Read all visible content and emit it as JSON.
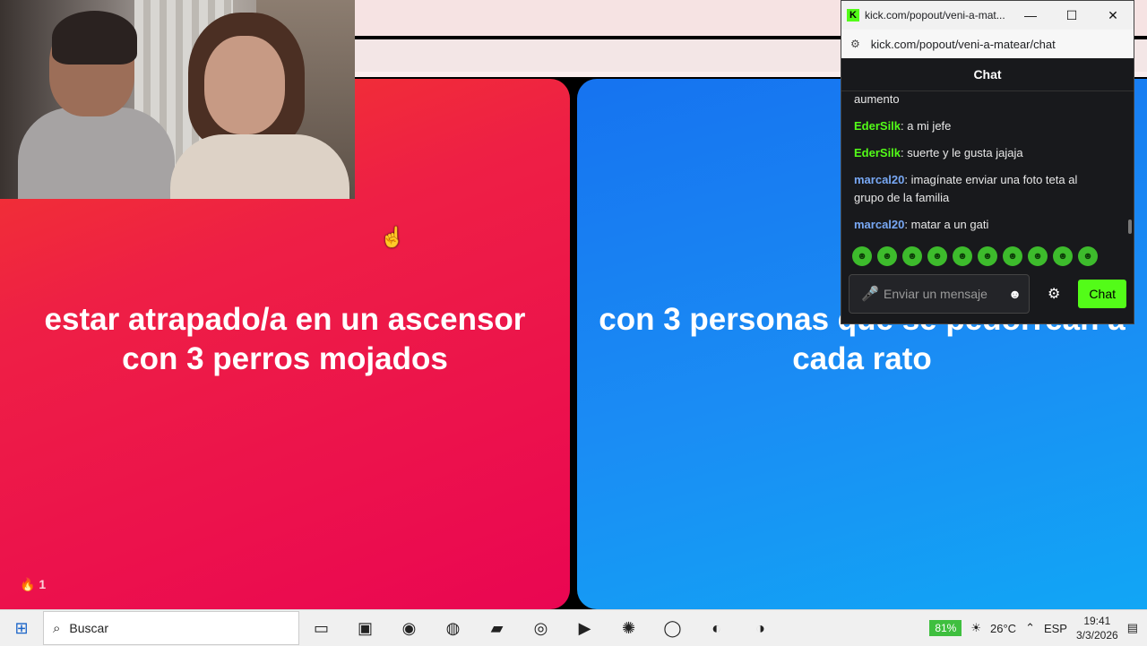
{
  "panels": {
    "left_text": "estar atrapado/a en un ascensor con 3 perros mojados",
    "right_text": "con 3 personas que se pedorrean a cada rato",
    "left_count": "1"
  },
  "popup": {
    "window_title": "kick.com/popout/veni-a-mat...",
    "url": "kick.com/popout/veni-a-matear/chat",
    "header": "Chat",
    "messages": [
      {
        "user": "",
        "text": "aumento"
      },
      {
        "user": "EderSilk",
        "text": ": a mi jefe"
      },
      {
        "user": "EderSilk",
        "text": ": suerte y le gusta jajaja"
      },
      {
        "user": "marcal20",
        "text": ": imagínate enviar una foto teta al grupo de la familia"
      },
      {
        "user": "marcal20",
        "text": ": matar a un gati"
      }
    ],
    "input_placeholder": "Enviar un mensaje",
    "send_label": "Chat"
  },
  "taskbar": {
    "search_label": "Buscar",
    "battery": "81%",
    "temperature": "26°C",
    "language": "ESP",
    "time": "19:41",
    "date": "3/3/2026"
  },
  "colors": {
    "accent": "#53fc18",
    "user_green": "#53fc18",
    "user_blue": "#78a8f4",
    "left_panel": "#ea0652",
    "right_panel": "#1a8df4"
  }
}
